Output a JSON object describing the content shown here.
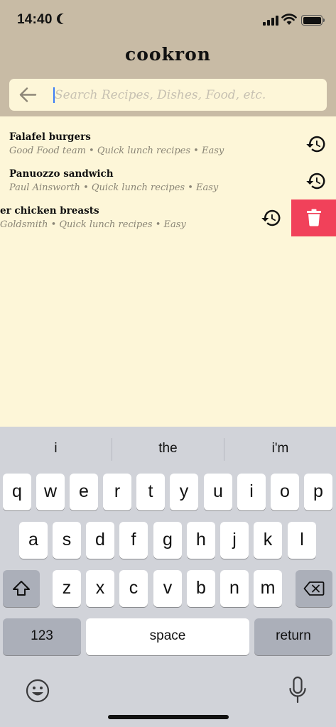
{
  "status_bar": {
    "time": "14:40"
  },
  "app": {
    "title": "cookron"
  },
  "search": {
    "placeholder": "Search Recipes, Dishes, Food, etc.",
    "value": ""
  },
  "history": [
    {
      "title": "Falafel burgers",
      "meta": "Good Food team • Quick lunch recipes • Easy"
    },
    {
      "title": "Panuozzo sandwich",
      "meta": "Paul Ainsworth • Quick lunch recipes • Easy"
    },
    {
      "title": "er chicken breasts",
      "meta": "Goldsmith • Quick lunch recipes • Easy"
    }
  ],
  "keyboard": {
    "suggestions": [
      "i",
      "the",
      "i'm"
    ],
    "row1": [
      "q",
      "w",
      "e",
      "r",
      "t",
      "y",
      "u",
      "i",
      "o",
      "p"
    ],
    "row2": [
      "a",
      "s",
      "d",
      "f",
      "g",
      "h",
      "j",
      "k",
      "l"
    ],
    "row3": [
      "z",
      "x",
      "c",
      "v",
      "b",
      "n",
      "m"
    ],
    "numbers_label": "123",
    "space_label": "space",
    "return_label": "return"
  },
  "colors": {
    "header": "#c8bba5",
    "background": "#fdf6d8",
    "delete": "#f1415a",
    "keyboard": "#d1d3d9"
  },
  "icons": [
    "back-arrow",
    "history",
    "trash",
    "shift",
    "backspace",
    "emoji",
    "microphone"
  ]
}
